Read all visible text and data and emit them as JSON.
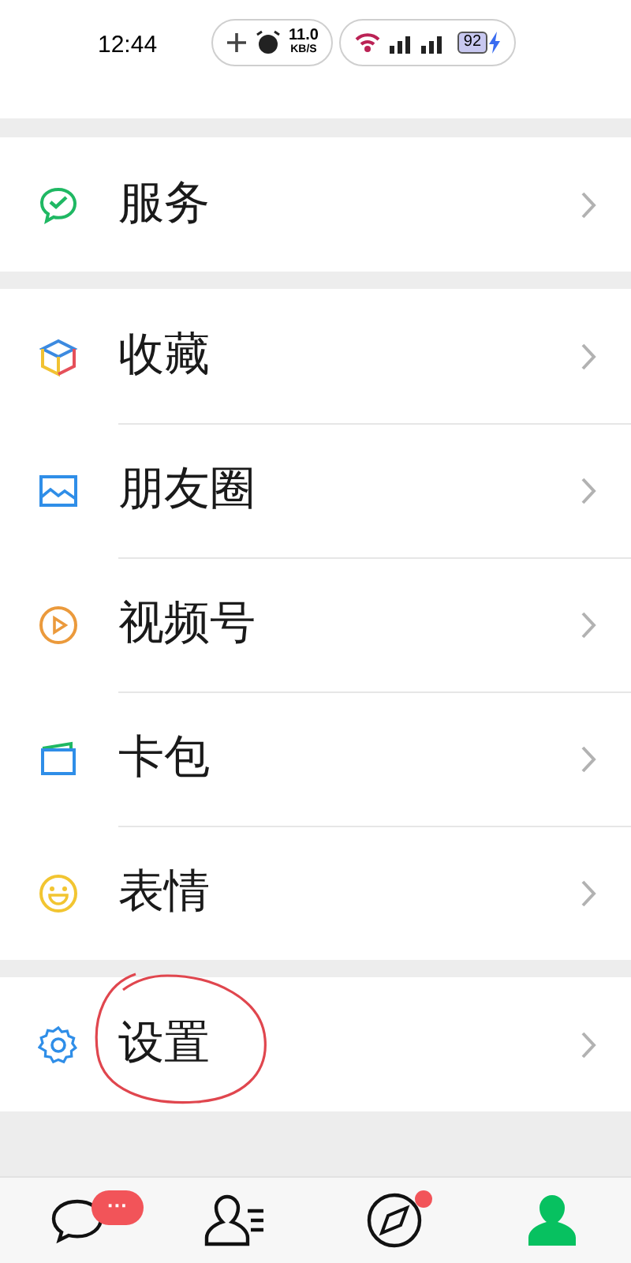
{
  "status_bar": {
    "time": "12:44",
    "net_speed": "11.0",
    "net_unit": "KB/S",
    "battery": "92"
  },
  "sections": [
    {
      "items": [
        {
          "kind": "service",
          "label": "服务",
          "circled": false
        }
      ]
    },
    {
      "items": [
        {
          "kind": "favorites",
          "label": "收藏",
          "circled": false
        },
        {
          "kind": "moments",
          "label": "朋友圈",
          "circled": false
        },
        {
          "kind": "channels",
          "label": "视频号",
          "circled": false
        },
        {
          "kind": "cards",
          "label": "卡包",
          "circled": false
        },
        {
          "kind": "stickers",
          "label": "表情",
          "circled": false
        }
      ]
    },
    {
      "items": [
        {
          "kind": "settings",
          "label": "设置",
          "circled": true
        }
      ]
    }
  ],
  "tabs": [
    {
      "kind": "chats",
      "selected": false,
      "badge": "···",
      "dot": false
    },
    {
      "kind": "contacts",
      "selected": false,
      "dot": false
    },
    {
      "kind": "discover",
      "selected": false,
      "dot": true
    },
    {
      "kind": "me",
      "selected": true,
      "dot": false
    }
  ]
}
